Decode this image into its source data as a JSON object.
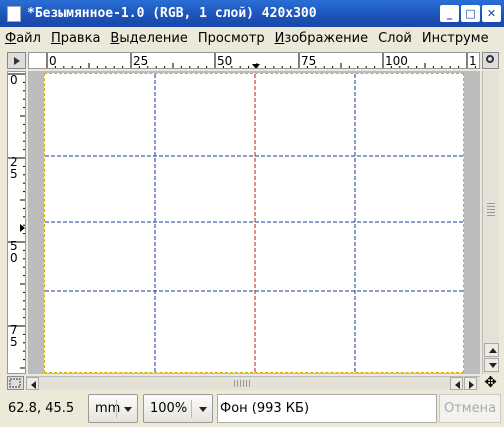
{
  "window": {
    "title": "*Безымянное-1.0 (RGB, 1 слой) 420x300",
    "min_glyph": "_",
    "max_glyph": "□",
    "close_glyph": "✕"
  },
  "menu": [
    {
      "accel": "Ф",
      "rest": "айл"
    },
    {
      "accel": "П",
      "rest": "равка"
    },
    {
      "accel": "В",
      "rest": "ыделение"
    },
    {
      "accel": "",
      "rest": "Просмотр"
    },
    {
      "accel": "И",
      "rest": "зображение"
    },
    {
      "accel": "",
      "rest": "Слой"
    },
    {
      "accel": "",
      "rest": "Инструме"
    }
  ],
  "hruler": {
    "labels": [
      "0",
      "25",
      "50",
      "75",
      "100",
      "1"
    ]
  },
  "vruler": {
    "labels": [
      "0",
      "2\n5",
      "5\n0",
      "7\n5"
    ]
  },
  "status": {
    "coords": "62.8, 45.5",
    "units": "mm",
    "zoom": "100%",
    "layer_info": "Фон (993 КБ)",
    "cancel": "Отмена"
  },
  "colors": {
    "guide_blue": "#1a3a9a",
    "guide_red": "#c01818",
    "selection": "#d4b000"
  },
  "icons": {
    "move": "✥"
  }
}
